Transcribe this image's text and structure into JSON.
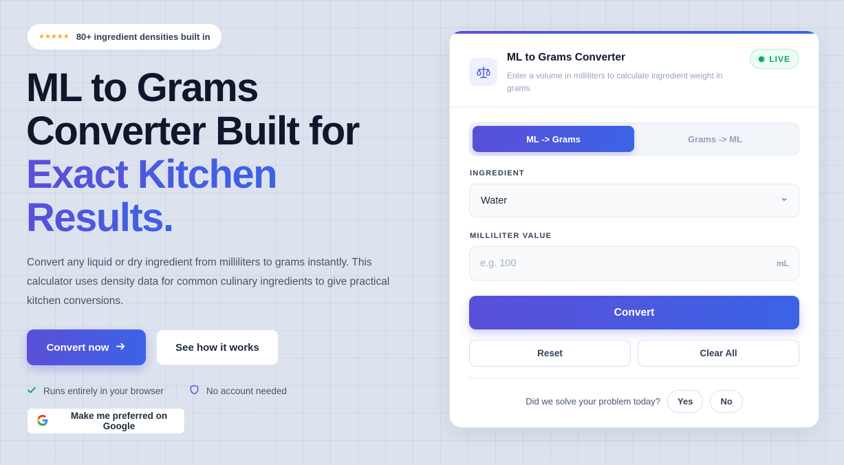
{
  "badge": {
    "stars": "★★★★★",
    "text": "80+ ingredient densities built in"
  },
  "hero": {
    "title_line1": "ML to Grams",
    "title_line2": "Converter Built for",
    "title_accent_line1": "Exact Kitchen",
    "title_accent_line2": "Results.",
    "description": "Convert any liquid or dry ingredient from milliliters to grams instantly. This calculator uses density data for common culinary ingredients to give practical kitchen conversions.",
    "primary_cta": "Convert now",
    "secondary_cta": "See how it works",
    "features": [
      "Runs entirely in your browser",
      "No account needed"
    ],
    "google_button": "Make me preferred on Google"
  },
  "card": {
    "title": "ML to Grams Converter",
    "subtitle": "Enter a volume in milliliters to calculate ingredient weight in grams.",
    "live_label": "LIVE",
    "tabs": [
      {
        "label": "ML -> Grams",
        "active": true
      },
      {
        "label": "Grams -> ML",
        "active": false
      }
    ],
    "ingredient_label": "INGREDIENT",
    "ingredient_value": "Water",
    "ml_label": "MILLILITER VALUE",
    "ml_placeholder": "e.g. 100",
    "ml_value": "",
    "unit": "mL",
    "convert_label": "Convert",
    "reset_label": "Reset",
    "clear_label": "Clear All",
    "feedback_question": "Did we solve your problem today?",
    "yes_label": "Yes",
    "no_label": "No"
  },
  "colors": {
    "accent_start": "#5b4fd8",
    "accent_end": "#3b63e6",
    "live_green": "#16a36a",
    "star": "#f5b11a"
  },
  "icons": [
    "arrow-right-icon",
    "check-icon",
    "shield-icon",
    "google-logo-icon",
    "scale-icon",
    "chevron-down-icon"
  ]
}
